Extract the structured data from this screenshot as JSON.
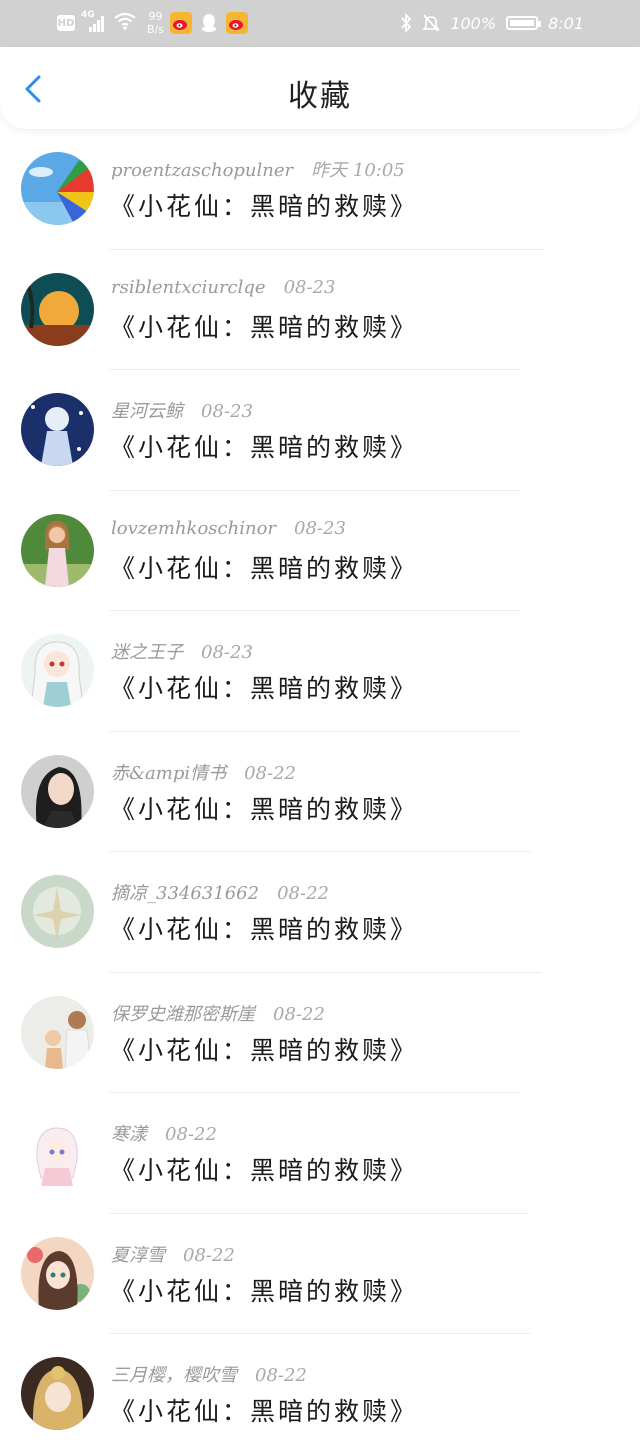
{
  "status_bar": {
    "hd": "HD",
    "network": "4G",
    "speed_value": "99",
    "speed_unit": "B/s",
    "battery": "100%",
    "time": "8:01",
    "icons": [
      "hd-icon",
      "signal-icon",
      "wifi-icon",
      "weibo-icon",
      "qq-icon",
      "weibo-icon",
      "bluetooth-icon",
      "mute-icon",
      "battery-icon"
    ]
  },
  "header": {
    "title": "收藏",
    "back_icon": "chevron-left-icon",
    "accent_color": "#2a8ff0"
  },
  "favorites": [
    {
      "user": "proentzaschopulner",
      "time": "昨天 10:05",
      "title": "《小花仙：黑暗的救赎》"
    },
    {
      "user": "rsiblentxciurclqe",
      "time": "08-23",
      "title": "《小花仙：黑暗的救赎》"
    },
    {
      "user": "星河云鲸",
      "time": "08-23",
      "title": "《小花仙：黑暗的救赎》"
    },
    {
      "user": "lovzemhkoschinor",
      "time": "08-23",
      "title": "《小花仙：黑暗的救赎》"
    },
    {
      "user": "迷之王子",
      "time": "08-23",
      "title": "《小花仙：黑暗的救赎》"
    },
    {
      "user": "赤&ampi情书",
      "time": "08-22",
      "title": "《小花仙：黑暗的救赎》"
    },
    {
      "user": "摘凉_334631662",
      "time": "08-22",
      "title": "《小花仙：黑暗的救赎》"
    },
    {
      "user": "保罗史潍那密斯崖",
      "time": "08-22",
      "title": "《小花仙：黑暗的救赎》"
    },
    {
      "user": "寒漾",
      "time": "08-22",
      "title": "《小花仙：黑暗的救赎》"
    },
    {
      "user": "夏淳雪",
      "time": "08-22",
      "title": "《小花仙：黑暗的救赎》"
    },
    {
      "user": "三月樱，樱吹雪",
      "time": "08-22",
      "title": "《小花仙：黑暗的救赎》"
    }
  ]
}
